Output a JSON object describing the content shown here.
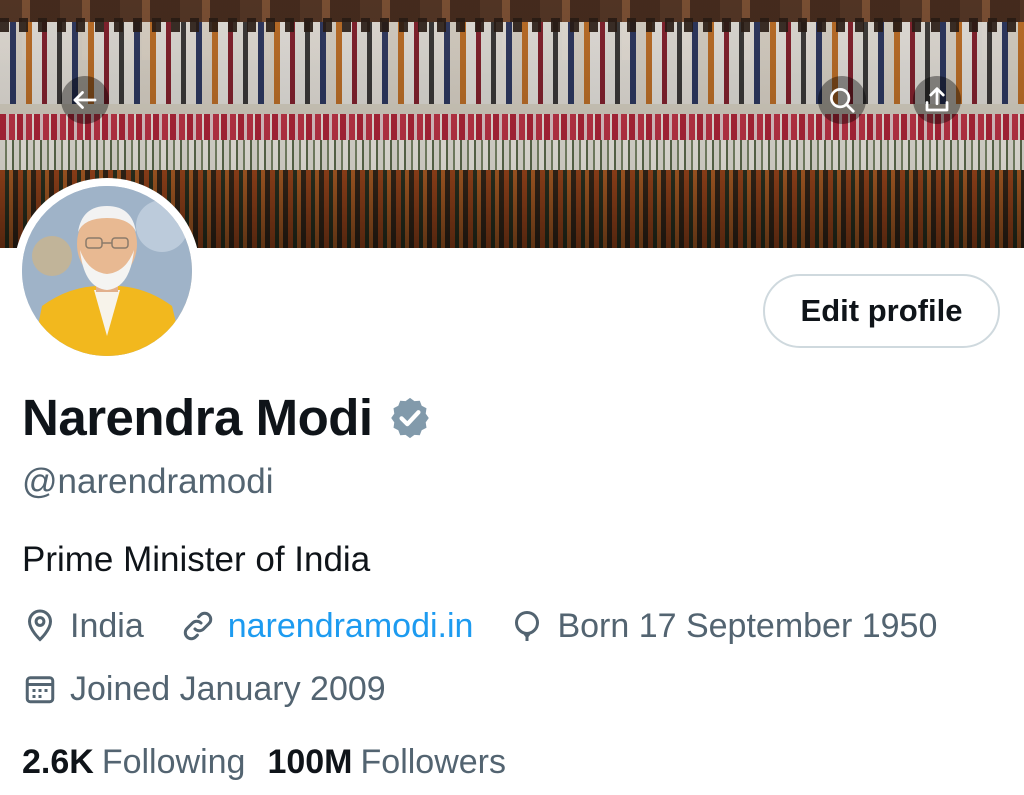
{
  "profile": {
    "name": "Narendra Modi",
    "handle": "@narendramodi",
    "bio": "Prime Minister of India",
    "location": "India",
    "website": "narendramodi.in",
    "birthday": "Born 17 September 1950",
    "joined": "Joined January 2009",
    "verified": true
  },
  "actions": {
    "edit_profile_label": "Edit profile"
  },
  "stats": {
    "following_count": "2.6K",
    "following_label": "Following",
    "followers_count": "100M",
    "followers_label": "Followers"
  },
  "icons": {
    "back": "arrow-left-icon",
    "search": "search-icon",
    "share": "share-icon",
    "verified": "verified-badge-icon",
    "location": "location-pin-icon",
    "link": "link-icon",
    "birthday": "balloon-icon",
    "calendar": "calendar-icon"
  },
  "colors": {
    "text_primary": "#0f1419",
    "text_secondary": "#536471",
    "link": "#1d9bf0",
    "verified_badge": "#829aab",
    "border": "#cfd9de"
  }
}
